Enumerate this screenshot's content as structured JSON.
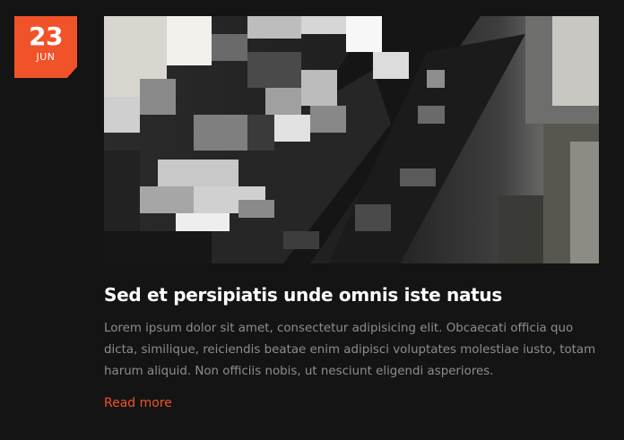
{
  "post": {
    "date": {
      "day": "23",
      "month": "JUN"
    },
    "image": {
      "alt": "Post thumbnail"
    },
    "title": "Sed et persipiatis unde omnis iste natus",
    "excerpt": "Lorem ipsum dolor sit amet, consectetur adipisicing elit. Obcaecati officia quo dicta, similique, reiciendis beatae enim adipisci voluptates molestiae iusto, totam harum aliquid. Non officiis nobis, ut nesciunt eligendi asperiores.",
    "read_more_label": "Read more"
  },
  "colors": {
    "background": "#141414",
    "accent": "#f0522a",
    "title": "#ffffff",
    "excerpt": "#8d8d8d"
  }
}
